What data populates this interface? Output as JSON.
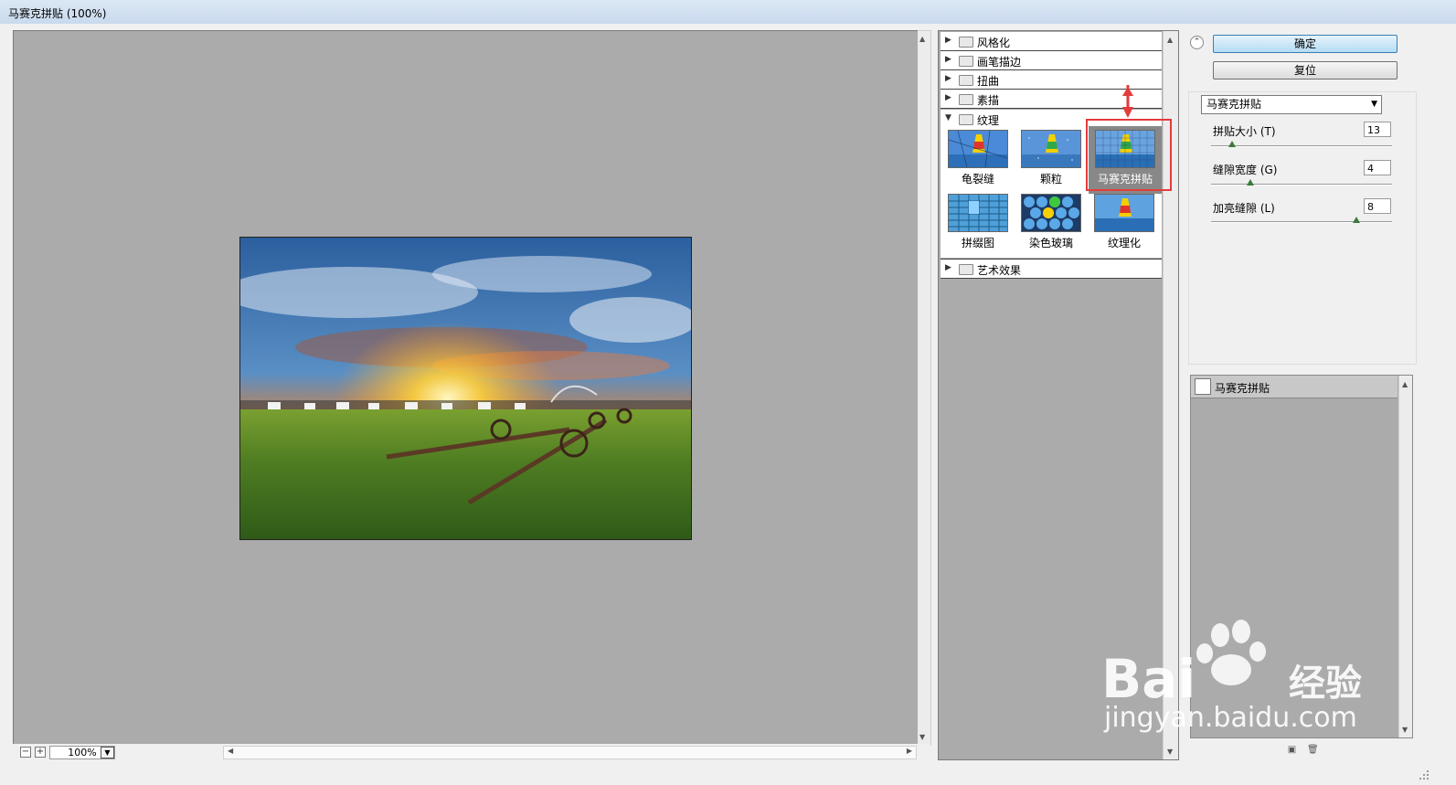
{
  "window": {
    "title": "马赛克拼贴 (100%)"
  },
  "preview": {
    "zoom_value": "100%",
    "zoom_out_icon": "minus-icon",
    "zoom_in_icon": "plus-icon"
  },
  "filter_browser": {
    "categories_top": [
      "风格化",
      "画笔描边",
      "扭曲",
      "素描"
    ],
    "expanded_category": "纹理",
    "filters": [
      "龟裂缝",
      "颗粒",
      "马赛克拼贴",
      "拼缀图",
      "染色玻璃",
      "纹理化"
    ],
    "selected_filter": "马赛克拼贴",
    "categories_bottom": [
      "艺术效果"
    ]
  },
  "settings": {
    "ok_label": "确定",
    "reset_label": "复位",
    "filter_select_value": "马赛克拼贴",
    "params": [
      {
        "label": "拼贴大小 (T)",
        "value": "13",
        "level": 0.12
      },
      {
        "label": "缝隙宽度 (G)",
        "value": "4",
        "level": 0.22
      },
      {
        "label": "加亮缝隙 (L)",
        "value": "8",
        "level": 0.8
      }
    ]
  },
  "layers": {
    "items": [
      "马赛克拼贴"
    ]
  },
  "watermark": {
    "text": "Bai 经验",
    "url_text": "jingyan.baidu.com"
  },
  "colors": {
    "highlight": "#e43b3b",
    "panel_gray": "#ababab",
    "ok_button": "#b5dcf5"
  }
}
